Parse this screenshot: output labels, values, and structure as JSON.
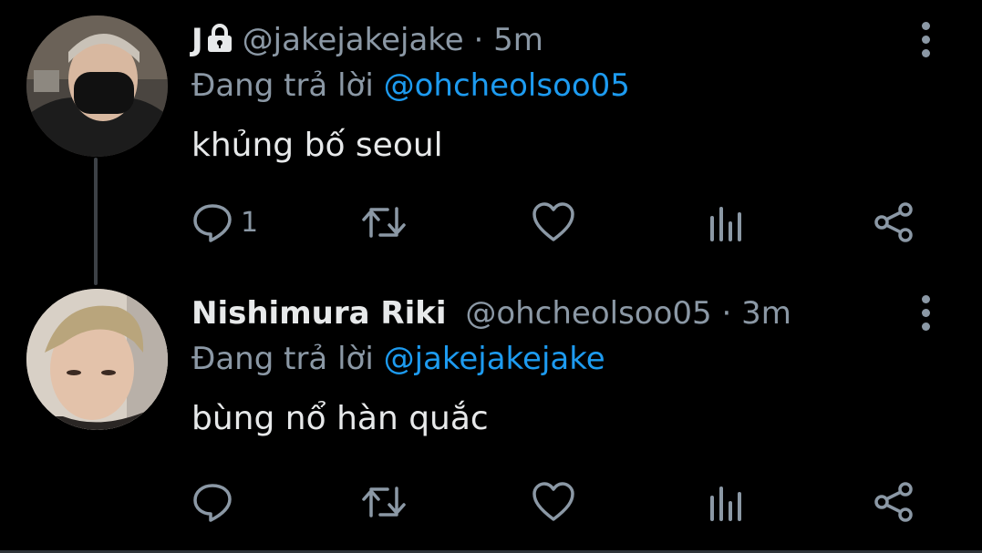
{
  "tweets": [
    {
      "name": "J",
      "handle": "@jakejakejake",
      "separator": "·",
      "time": "5m",
      "reply_prefix": "Đang trả lời",
      "reply_to": "@ohcheolsoo05",
      "text": "khủng bố seoul",
      "reply_count": "1",
      "locked": true
    },
    {
      "name": "Nishimura Riki",
      "handle": "@ohcheolsoo05",
      "separator": "·",
      "time": "3m",
      "reply_prefix": "Đang trả lời",
      "reply_to": "@jakejakejake",
      "text": "bùng nổ hàn quắc",
      "reply_count": "",
      "locked": false
    }
  ],
  "icons": {
    "reply": "reply-icon",
    "retweet": "retweet-icon",
    "like": "heart-icon",
    "analytics": "analytics-icon",
    "share": "share-icon",
    "more": "more-icon",
    "lock": "lock-icon"
  },
  "colors": {
    "background": "#000000",
    "text": "#e7e9ea",
    "muted": "#8b98a5",
    "mention": "#1d9bf0"
  }
}
